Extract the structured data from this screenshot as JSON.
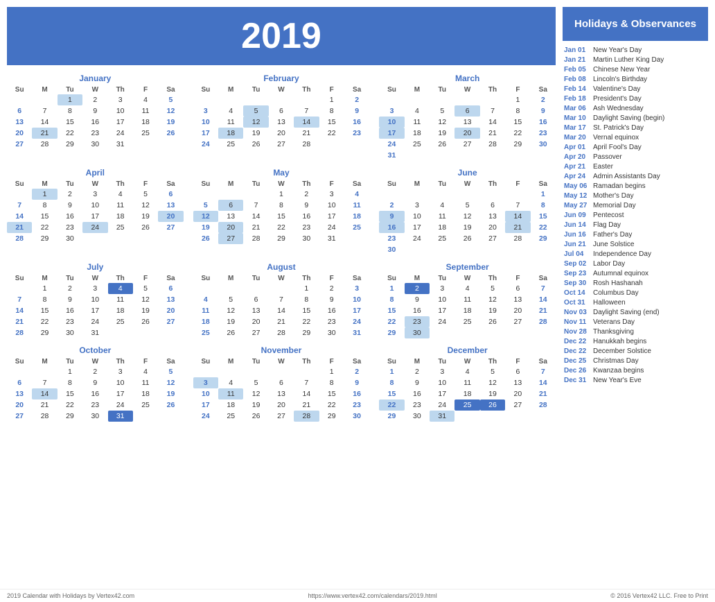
{
  "header": {
    "year": "2019",
    "bg_color": "#4472C4"
  },
  "months": [
    {
      "name": "January",
      "days": [
        {
          "week": [
            null,
            null,
            1,
            2,
            3,
            4,
            5
          ]
        },
        {
          "week": [
            6,
            7,
            8,
            9,
            10,
            11,
            12
          ]
        },
        {
          "week": [
            13,
            14,
            15,
            16,
            17,
            18,
            19
          ]
        },
        {
          "week": [
            20,
            21,
            22,
            23,
            24,
            25,
            26
          ]
        },
        {
          "week": [
            27,
            28,
            29,
            30,
            31,
            null,
            null
          ]
        }
      ],
      "highlighted": [
        1,
        21
      ],
      "highlighted_dark": [],
      "sunday_colored": [
        6,
        13,
        20,
        27
      ],
      "saturday_colored": [
        5,
        12,
        19,
        26
      ]
    },
    {
      "name": "February",
      "days": [
        {
          "week": [
            null,
            null,
            null,
            null,
            null,
            1,
            2
          ]
        },
        {
          "week": [
            3,
            4,
            5,
            6,
            7,
            8,
            9
          ]
        },
        {
          "week": [
            10,
            11,
            12,
            13,
            14,
            15,
            16
          ]
        },
        {
          "week": [
            17,
            18,
            19,
            20,
            21,
            22,
            23
          ]
        },
        {
          "week": [
            24,
            25,
            26,
            27,
            28,
            null,
            null
          ]
        }
      ],
      "highlighted": [
        5,
        12,
        14,
        18
      ],
      "highlighted_dark": [],
      "sunday_colored": [
        3,
        10,
        17,
        24
      ],
      "saturday_colored": [
        2,
        9,
        16,
        23
      ]
    },
    {
      "name": "March",
      "days": [
        {
          "week": [
            null,
            null,
            null,
            null,
            null,
            1,
            2
          ]
        },
        {
          "week": [
            3,
            4,
            5,
            6,
            7,
            8,
            9
          ]
        },
        {
          "week": [
            10,
            11,
            12,
            13,
            14,
            15,
            16
          ]
        },
        {
          "week": [
            17,
            18,
            19,
            20,
            21,
            22,
            23
          ]
        },
        {
          "week": [
            24,
            25,
            26,
            27,
            28,
            29,
            30
          ]
        },
        {
          "week": [
            31,
            null,
            null,
            null,
            null,
            null,
            null
          ]
        }
      ],
      "highlighted": [
        6,
        10,
        17,
        20
      ],
      "highlighted_dark": [],
      "sunday_colored": [
        3,
        10,
        17,
        24,
        31
      ],
      "saturday_colored": [
        2,
        9,
        16,
        23,
        30
      ]
    },
    {
      "name": "April",
      "days": [
        {
          "week": [
            null,
            1,
            2,
            3,
            4,
            5,
            6
          ]
        },
        {
          "week": [
            7,
            8,
            9,
            10,
            11,
            12,
            13
          ]
        },
        {
          "week": [
            14,
            15,
            16,
            17,
            18,
            19,
            20
          ]
        },
        {
          "week": [
            21,
            22,
            23,
            24,
            25,
            26,
            27
          ]
        },
        {
          "week": [
            28,
            29,
            30,
            null,
            null,
            null,
            null
          ]
        }
      ],
      "highlighted": [
        1,
        20,
        21,
        24
      ],
      "highlighted_dark": [],
      "sunday_colored": [
        7,
        14,
        21,
        28
      ],
      "saturday_colored": [
        6,
        13,
        20,
        27
      ]
    },
    {
      "name": "May",
      "days": [
        {
          "week": [
            null,
            null,
            null,
            1,
            2,
            3,
            4
          ]
        },
        {
          "week": [
            5,
            6,
            7,
            8,
            9,
            10,
            11
          ]
        },
        {
          "week": [
            12,
            13,
            14,
            15,
            16,
            17,
            18
          ]
        },
        {
          "week": [
            19,
            20,
            21,
            22,
            23,
            24,
            25
          ]
        },
        {
          "week": [
            26,
            27,
            28,
            29,
            30,
            31,
            null
          ]
        }
      ],
      "highlighted": [
        6,
        12,
        20,
        27
      ],
      "highlighted_dark": [],
      "sunday_colored": [
        5,
        12,
        19,
        26
      ],
      "saturday_colored": [
        4,
        11,
        18,
        25
      ]
    },
    {
      "name": "June",
      "days": [
        {
          "week": [
            null,
            null,
            null,
            null,
            null,
            null,
            1
          ]
        },
        {
          "week": [
            2,
            3,
            4,
            5,
            6,
            7,
            8
          ]
        },
        {
          "week": [
            9,
            10,
            11,
            12,
            13,
            14,
            15
          ]
        },
        {
          "week": [
            16,
            17,
            18,
            19,
            20,
            21,
            22
          ]
        },
        {
          "week": [
            23,
            24,
            25,
            26,
            27,
            28,
            29
          ]
        },
        {
          "week": [
            30,
            null,
            null,
            null,
            null,
            null,
            null
          ]
        }
      ],
      "highlighted": [
        9,
        14,
        16,
        21
      ],
      "highlighted_dark": [],
      "sunday_colored": [
        2,
        9,
        16,
        23,
        30
      ],
      "saturday_colored": [
        1,
        8,
        15,
        22,
        29
      ]
    },
    {
      "name": "July",
      "days": [
        {
          "week": [
            null,
            1,
            2,
            3,
            4,
            5,
            6
          ]
        },
        {
          "week": [
            7,
            8,
            9,
            10,
            11,
            12,
            13
          ]
        },
        {
          "week": [
            14,
            15,
            16,
            17,
            18,
            19,
            20
          ]
        },
        {
          "week": [
            21,
            22,
            23,
            24,
            25,
            26,
            27
          ]
        },
        {
          "week": [
            28,
            29,
            30,
            31,
            null,
            null,
            null
          ]
        }
      ],
      "highlighted": [
        4
      ],
      "highlighted_dark": [],
      "sunday_colored": [
        7,
        14,
        21,
        28
      ],
      "saturday_colored": [
        6,
        13,
        20,
        27
      ]
    },
    {
      "name": "August",
      "days": [
        {
          "week": [
            null,
            null,
            null,
            null,
            1,
            2,
            3
          ]
        },
        {
          "week": [
            4,
            5,
            6,
            7,
            8,
            9,
            10
          ]
        },
        {
          "week": [
            11,
            12,
            13,
            14,
            15,
            16,
            17
          ]
        },
        {
          "week": [
            18,
            19,
            20,
            21,
            22,
            23,
            24
          ]
        },
        {
          "week": [
            25,
            26,
            27,
            28,
            29,
            30,
            31
          ]
        }
      ],
      "highlighted": [],
      "highlighted_dark": [],
      "sunday_colored": [
        4,
        11,
        18,
        25
      ],
      "saturday_colored": [
        3,
        10,
        17,
        24,
        31
      ]
    },
    {
      "name": "September",
      "days": [
        {
          "week": [
            1,
            2,
            3,
            4,
            5,
            6,
            7
          ]
        },
        {
          "week": [
            8,
            9,
            10,
            11,
            12,
            13,
            14
          ]
        },
        {
          "week": [
            15,
            16,
            17,
            18,
            19,
            20,
            21
          ]
        },
        {
          "week": [
            22,
            23,
            24,
            25,
            26,
            27,
            28
          ]
        },
        {
          "week": [
            29,
            30,
            null,
            null,
            null,
            null,
            null
          ]
        }
      ],
      "highlighted": [
        2,
        23
      ],
      "highlighted_dark": [],
      "sunday_colored": [
        1,
        8,
        15,
        22,
        29
      ],
      "saturday_colored": [
        7,
        14,
        21,
        28
      ]
    },
    {
      "name": "October",
      "days": [
        {
          "week": [
            null,
            null,
            1,
            2,
            3,
            4,
            5
          ]
        },
        {
          "week": [
            6,
            7,
            8,
            9,
            10,
            11,
            12
          ]
        },
        {
          "week": [
            13,
            14,
            15,
            16,
            17,
            18,
            19
          ]
        },
        {
          "week": [
            20,
            21,
            22,
            23,
            24,
            25,
            26
          ]
        },
        {
          "week": [
            27,
            28,
            29,
            30,
            31,
            null,
            null
          ]
        }
      ],
      "highlighted": [
        14,
        31
      ],
      "highlighted_dark": [],
      "sunday_colored": [
        6,
        13,
        20,
        27
      ],
      "saturday_colored": [
        5,
        12,
        19,
        26
      ]
    },
    {
      "name": "November",
      "days": [
        {
          "week": [
            null,
            null,
            null,
            null,
            null,
            1,
            2
          ]
        },
        {
          "week": [
            3,
            4,
            5,
            6,
            7,
            8,
            9
          ]
        },
        {
          "week": [
            10,
            11,
            12,
            13,
            14,
            15,
            16
          ]
        },
        {
          "week": [
            17,
            18,
            19,
            20,
            21,
            22,
            23
          ]
        },
        {
          "week": [
            24,
            25,
            26,
            27,
            28,
            29,
            30
          ]
        }
      ],
      "highlighted": [
        3,
        11,
        28
      ],
      "highlighted_dark": [],
      "sunday_colored": [
        3,
        10,
        17,
        24
      ],
      "saturday_colored": [
        2,
        9,
        16,
        23,
        30
      ]
    },
    {
      "name": "December",
      "days": [
        {
          "week": [
            1,
            2,
            3,
            4,
            5,
            6,
            7
          ]
        },
        {
          "week": [
            8,
            9,
            10,
            11,
            12,
            13,
            14
          ]
        },
        {
          "week": [
            15,
            16,
            17,
            18,
            19,
            20,
            21
          ]
        },
        {
          "week": [
            22,
            23,
            24,
            25,
            26,
            27,
            28
          ]
        },
        {
          "week": [
            29,
            30,
            31,
            null,
            null,
            null,
            null
          ]
        }
      ],
      "highlighted": [
        22,
        25,
        26,
        31
      ],
      "highlighted_dark": [
        25,
        26
      ],
      "sunday_colored": [
        1,
        8,
        15,
        22,
        29
      ],
      "saturday_colored": [
        7,
        14,
        21,
        28
      ]
    }
  ],
  "sidebar": {
    "title": "Holidays &\nObservances",
    "holidays": [
      {
        "date": "Jan 01",
        "name": "New Year's Day"
      },
      {
        "date": "Jan 21",
        "name": "Martin Luther King Day"
      },
      {
        "date": "Feb 05",
        "name": "Chinese New Year"
      },
      {
        "date": "Feb 08",
        "name": "Lincoln's Birthday"
      },
      {
        "date": "Feb 14",
        "name": "Valentine's Day"
      },
      {
        "date": "Feb 18",
        "name": "President's Day"
      },
      {
        "date": "Mar 06",
        "name": "Ash Wednesday"
      },
      {
        "date": "Mar 10",
        "name": "Daylight Saving (begin)"
      },
      {
        "date": "Mar 17",
        "name": "St. Patrick's Day"
      },
      {
        "date": "Mar 20",
        "name": "Vernal equinox"
      },
      {
        "date": "Apr 01",
        "name": "April Fool's Day"
      },
      {
        "date": "Apr 20",
        "name": "Passover"
      },
      {
        "date": "Apr 21",
        "name": "Easter"
      },
      {
        "date": "Apr 24",
        "name": "Admin Assistants Day"
      },
      {
        "date": "May 06",
        "name": "Ramadan begins"
      },
      {
        "date": "May 12",
        "name": "Mother's Day"
      },
      {
        "date": "May 27",
        "name": "Memorial Day"
      },
      {
        "date": "Jun 09",
        "name": "Pentecost"
      },
      {
        "date": "Jun 14",
        "name": "Flag Day"
      },
      {
        "date": "Jun 16",
        "name": "Father's Day"
      },
      {
        "date": "Jun 21",
        "name": "June Solstice"
      },
      {
        "date": "Jul 04",
        "name": "Independence Day"
      },
      {
        "date": "Sep 02",
        "name": "Labor Day"
      },
      {
        "date": "Sep 23",
        "name": "Autumnal equinox"
      },
      {
        "date": "Sep 30",
        "name": "Rosh Hashanah"
      },
      {
        "date": "Oct 14",
        "name": "Columbus Day"
      },
      {
        "date": "Oct 31",
        "name": "Halloween"
      },
      {
        "date": "Nov 03",
        "name": "Daylight Saving (end)"
      },
      {
        "date": "Nov 11",
        "name": "Veterans Day"
      },
      {
        "date": "Nov 28",
        "name": "Thanksgiving"
      },
      {
        "date": "Dec 22",
        "name": "Hanukkah begins"
      },
      {
        "date": "Dec 22",
        "name": "December Solstice"
      },
      {
        "date": "Dec 25",
        "name": "Christmas Day"
      },
      {
        "date": "Dec 26",
        "name": "Kwanzaa begins"
      },
      {
        "date": "Dec 31",
        "name": "New Year's Eve"
      }
    ]
  },
  "footer": {
    "left": "2019 Calendar with Holidays by Vertex42.com",
    "center": "https://www.vertex42.com/calendars/2019.html",
    "right": "© 2016 Vertex42 LLC. Free to Print"
  }
}
